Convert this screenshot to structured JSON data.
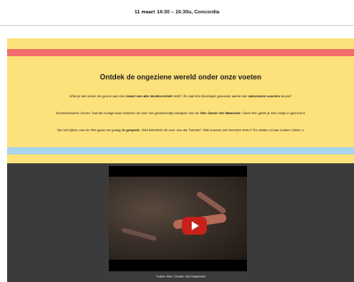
{
  "event": {
    "datetime": "11 maart 14:30 – 16:30u, Concordia"
  },
  "section": {
    "heading": "Ontdek de ongeziene wereld onder onze voeten",
    "lines": [
      [
        {
          "t": "Wist je dat onder de grond van een ",
          "b": false
        },
        {
          "t": "kwart van alle biodiversiteit",
          "b": true
        },
        {
          "t": " leeft? En dat één theelepel gezonde aarde wel ",
          "b": false
        },
        {
          "t": "duizenden soorten",
          "b": true
        },
        {
          "t": " bevat?",
          "b": false
        }
      ],
      [
        {
          "t": "Kennisnetwerk Onder Twente nodigt haar netwerk uit voor het gezamenlijk bekijken van de ",
          "b": false
        },
        {
          "t": "film Onder het Maaiveld",
          "b": true
        },
        {
          "t": ". Deze film geeft je een inkijk in gezond b",
          "b": false
        }
      ],
      [
        {
          "t": "Na het kijken van de film gaan we graag ",
          "b": false
        },
        {
          "t": "in gesprek",
          "b": true
        },
        {
          "t": ". Wat betekent dit voor ons als Twente? Wat kunnen we hiermee leren? En welke rol kan bodem hierin s",
          "b": false
        }
      ]
    ]
  },
  "video": {
    "caption": "Trailer film: Onder het Maaiveld",
    "play_icon": "play-icon",
    "play_color": "#c8201b"
  },
  "colors": {
    "yellow": "#fde17a",
    "red_stripe": "#f26d6d",
    "blue_stripe": "#a8d4ec",
    "dark": "#3b3b3b"
  }
}
